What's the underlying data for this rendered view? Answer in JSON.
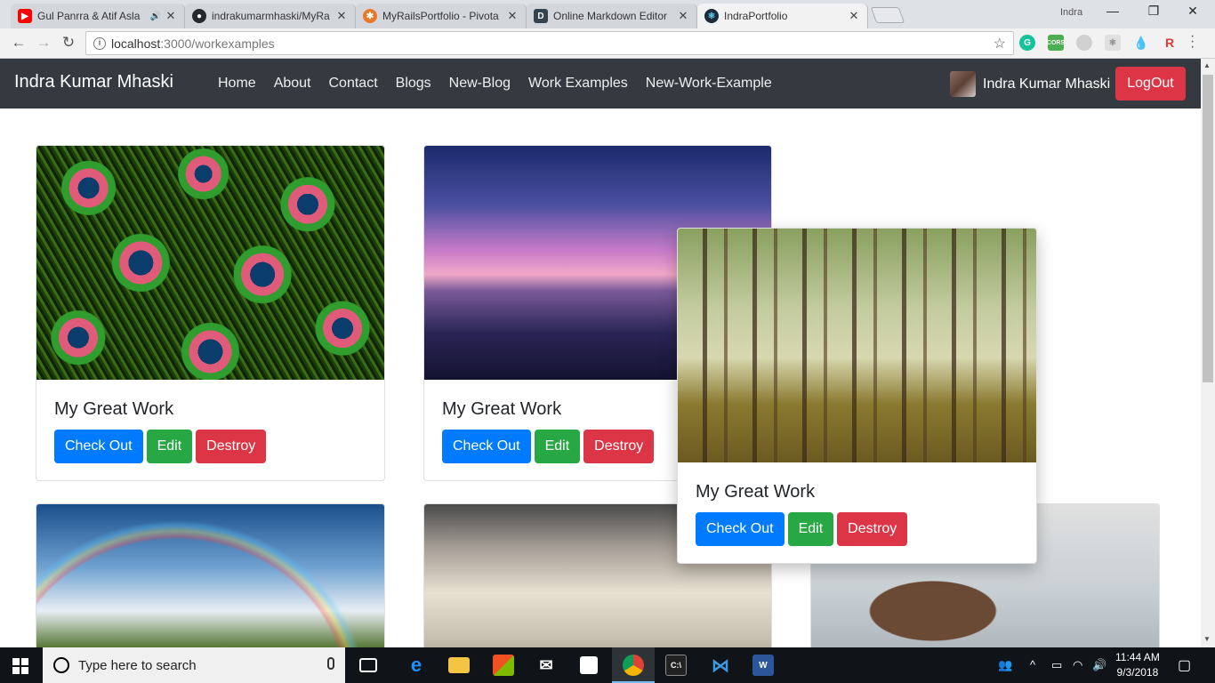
{
  "browser": {
    "tabs": [
      {
        "title": "Gul Panrra & Atif Asla",
        "favicon": "youtube-icon",
        "color": "#ff0000"
      },
      {
        "title": "indrakumarmhaski/MyRa",
        "favicon": "github-icon",
        "color": "#24292e"
      },
      {
        "title": "MyRailsPortfolio - Pivota",
        "favicon": "pivotal-icon",
        "color": "#e8782a"
      },
      {
        "title": "Online Markdown Editor",
        "favicon": "dillinger-icon",
        "color": "#35434e"
      },
      {
        "title": "IndraPortfolio",
        "favicon": "react-icon",
        "color": "#1c2b3a"
      }
    ],
    "user_label": "Indra",
    "url_host": "localhost",
    "url_rest": ":3000/workexamples"
  },
  "navbar": {
    "brand": "Indra Kumar Mhaski",
    "links": [
      "Home",
      "About",
      "Contact",
      "Blogs",
      "New-Blog",
      "Work Examples",
      "New-Work-Example"
    ],
    "user_name": "Indra Kumar Mhaski",
    "logout_label": "LogOut"
  },
  "cards": [
    {
      "title": "My Great Work",
      "image": "peacock-feathers"
    },
    {
      "title": "My Great Work",
      "image": "sunset-boat"
    },
    {
      "title": "My Great Work",
      "image": "forest"
    }
  ],
  "buttons": {
    "check_out": "Check Out",
    "edit": "Edit",
    "destroy": "Destroy"
  },
  "colors": {
    "primary": "#007bff",
    "success": "#28a745",
    "danger": "#dc3545",
    "navbar": "#343a40"
  },
  "taskbar": {
    "search_placeholder": "Type here to search",
    "time": "11:44 AM",
    "date": "9/3/2018"
  }
}
